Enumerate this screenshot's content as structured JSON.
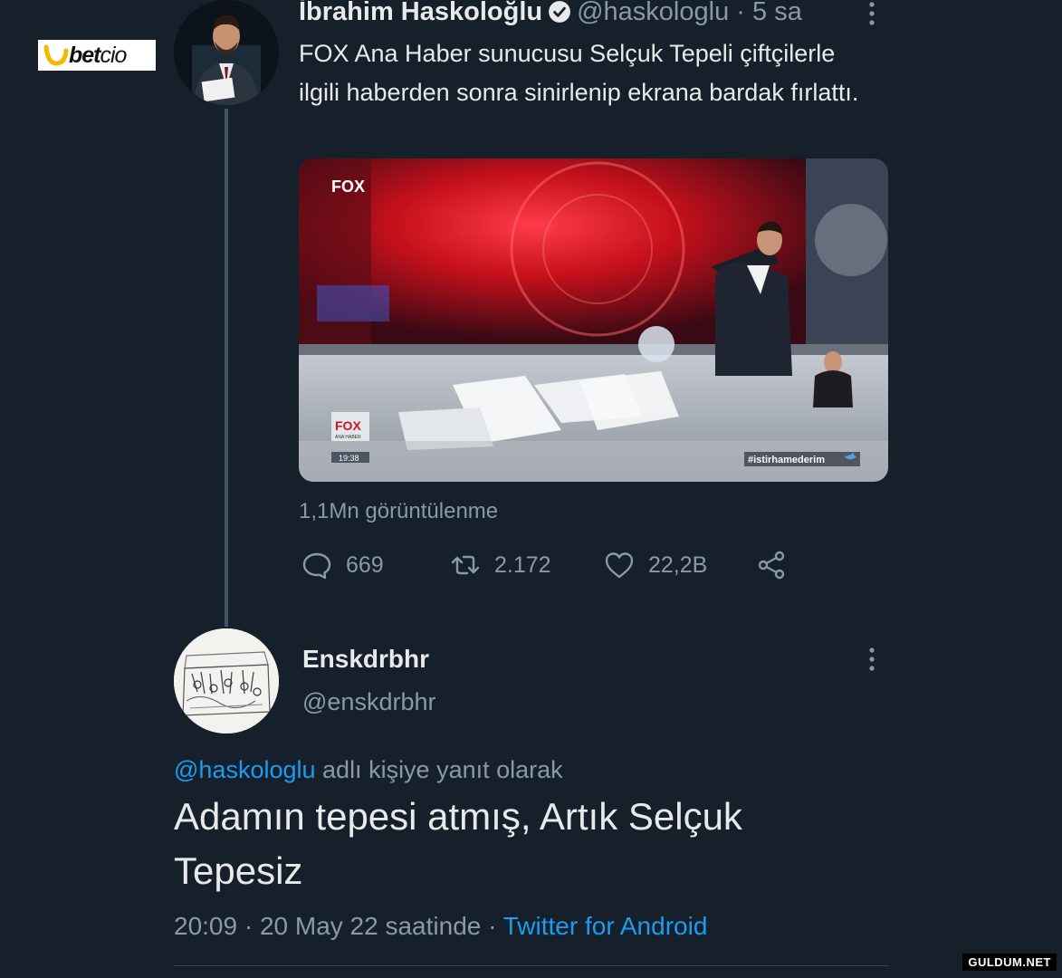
{
  "brand_logo": {
    "text_bold": "bet",
    "text_thin": "cio"
  },
  "tweet": {
    "author_name": "İbrahim Haskoloğlu",
    "handle": "@haskologlu",
    "separator": "·",
    "time": "5 sa",
    "text": "FOX Ana Haber sunucusu Selçuk Tepeli çiftçilerle ilgili haberden sonra sinirlenip ekrana bardak fırlattı.",
    "media": {
      "channel_logo": "FOX",
      "lower_logo": "FOX",
      "lower_sub": "ANA HABER",
      "clock": "19:38",
      "hashtag": "#istirhamederim"
    },
    "views": "1,1Mn görüntülenme",
    "actions": {
      "replies": "669",
      "retweets": "2.172",
      "likes": "22,2B"
    }
  },
  "reply": {
    "author_name": "Enskdrbhr",
    "handle": "@enskdrbhr",
    "reply_mention": "@haskologlu",
    "reply_suffix": "adlı kişiye yanıt olarak",
    "text": "Adamın tepesi atmış, Artık Selçuk Tepesiz",
    "timestamp": "20:09 · 20 May 22 saatinde",
    "separator": "·",
    "source": "Twitter for Android"
  },
  "watermark": "GULDUM.NET",
  "colors": {
    "background": "#15202b",
    "accent": "#1d9bf0",
    "muted": "#8b98a5",
    "text": "#e7e9ea"
  },
  "icons": [
    "verified-badge-icon",
    "more-icon",
    "reply-icon",
    "retweet-icon",
    "like-icon",
    "share-icon"
  ]
}
